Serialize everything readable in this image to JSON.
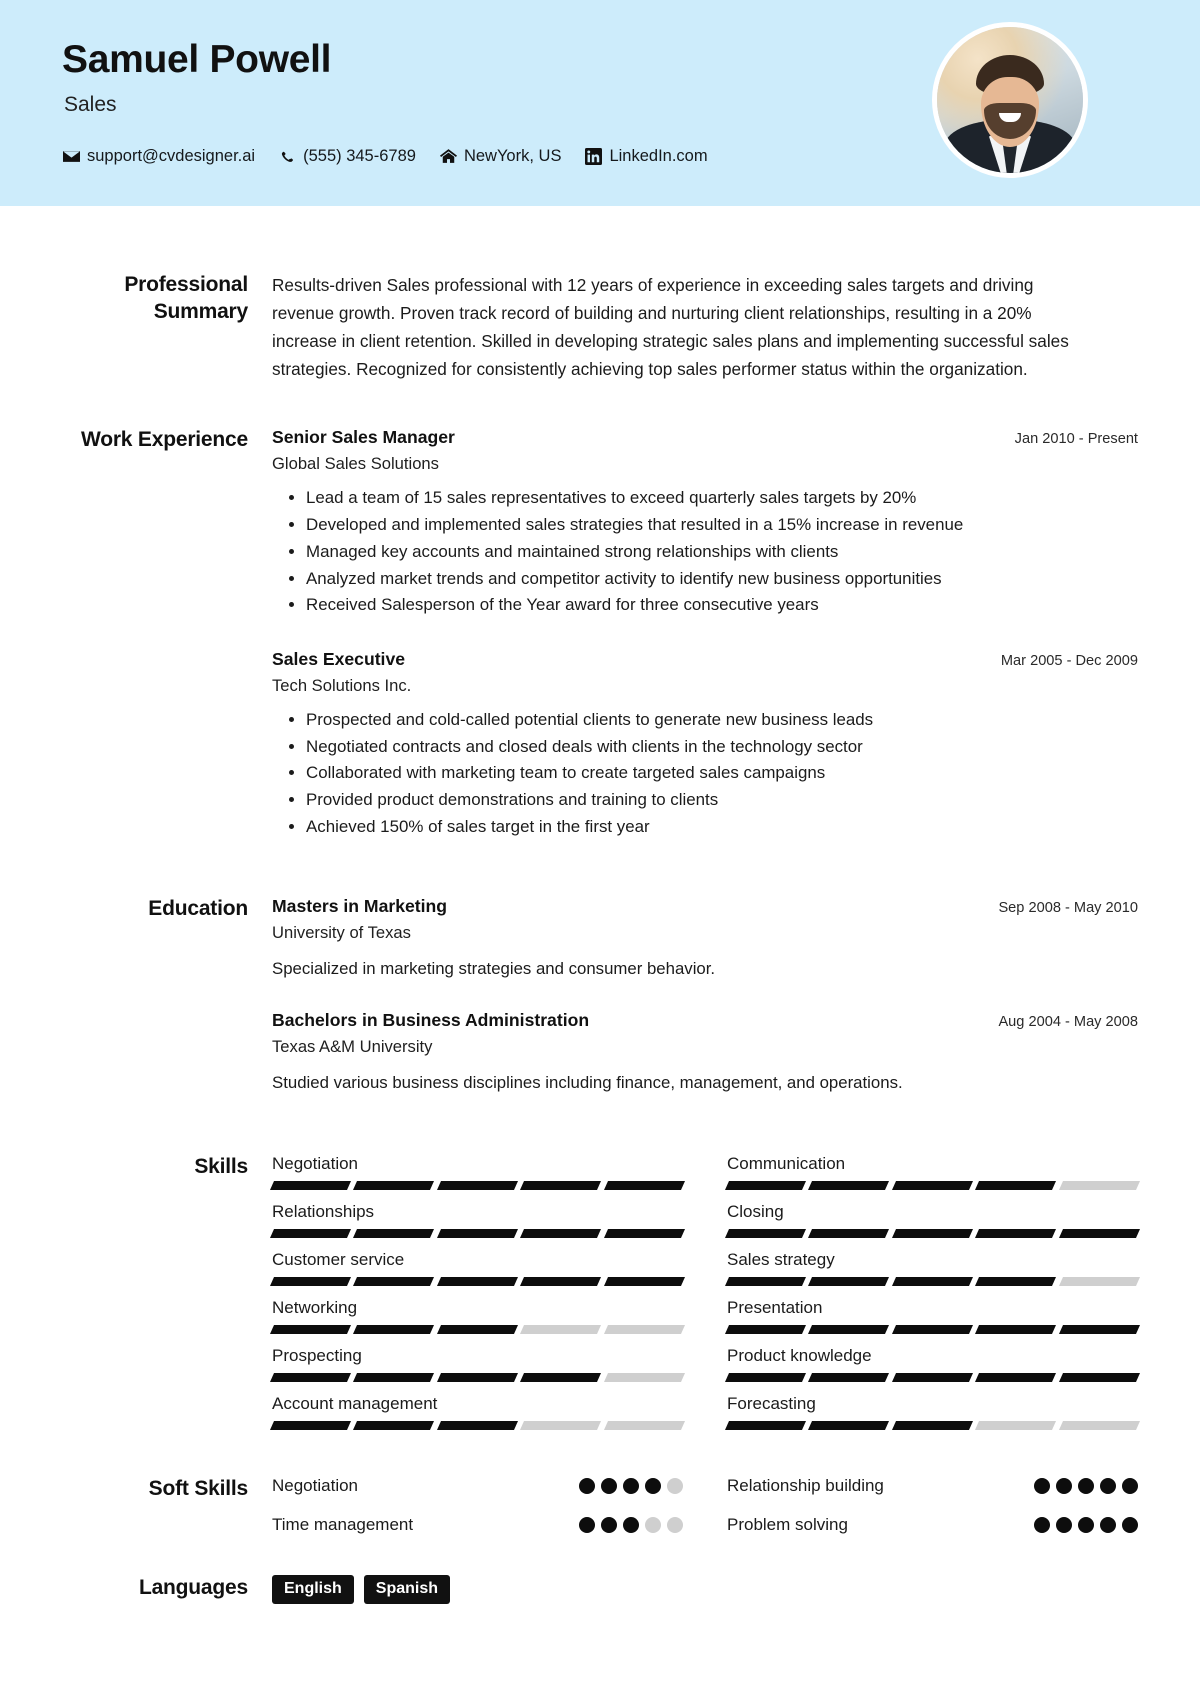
{
  "header": {
    "name": "Samuel Powell",
    "role": "Sales",
    "background_color": "#cdecfb",
    "contacts": [
      {
        "icon": "email-icon",
        "text": "support@cvdesigner.ai"
      },
      {
        "icon": "phone-icon",
        "text": "(555) 345-6789"
      },
      {
        "icon": "home-icon",
        "text": "NewYork, US"
      },
      {
        "icon": "linkedin-icon",
        "text": "LinkedIn.com"
      }
    ]
  },
  "summary": {
    "label": "Professional Summary",
    "text": "Results-driven Sales professional with 12 years of experience in exceeding sales targets and driving revenue growth. Proven track record of building and nurturing client relationships, resulting in a 20% increase in client retention. Skilled in developing strategic sales plans and implementing successful sales strategies. Recognized for consistently achieving top sales performer status within the organization."
  },
  "work": {
    "label": "Work Experience",
    "entries": [
      {
        "title": "Senior Sales Manager",
        "org": "Global Sales Solutions",
        "date": "Jan 2010 - Present",
        "bullets": [
          "Lead a team of 15 sales representatives to exceed quarterly sales targets by 20%",
          "Developed and implemented sales strategies that resulted in a 15% increase in revenue",
          "Managed key accounts and maintained strong relationships with clients",
          "Analyzed market trends and competitor activity to identify new business opportunities",
          "Received Salesperson of the Year award for three consecutive years"
        ]
      },
      {
        "title": "Sales Executive",
        "org": "Tech Solutions Inc.",
        "date": "Mar 2005 - Dec 2009",
        "bullets": [
          "Prospected and cold-called potential clients to generate new business leads",
          "Negotiated contracts and closed deals with clients in the technology sector",
          "Collaborated with marketing team to create targeted sales campaigns",
          "Provided product demonstrations and training to clients",
          "Achieved 150% of sales target in the first year"
        ]
      }
    ]
  },
  "education": {
    "label": "Education",
    "entries": [
      {
        "title": "Masters in Marketing",
        "org": "University of Texas",
        "date": "Sep 2008 - May 2010",
        "desc": "Specialized in marketing strategies and consumer behavior."
      },
      {
        "title": "Bachelors in Business Administration",
        "org": "Texas A&M University",
        "date": "Aug 2004 - May 2008",
        "desc": "Studied various business disciplines including finance, management, and operations."
      }
    ]
  },
  "skills": {
    "label": "Skills",
    "max": 5,
    "items": [
      {
        "name": "Negotiation",
        "level": 5
      },
      {
        "name": "Communication",
        "level": 4
      },
      {
        "name": "Relationships",
        "level": 5
      },
      {
        "name": "Closing",
        "level": 5
      },
      {
        "name": "Customer service",
        "level": 5
      },
      {
        "name": "Sales strategy",
        "level": 4
      },
      {
        "name": "Networking",
        "level": 3
      },
      {
        "name": "Presentation",
        "level": 5
      },
      {
        "name": "Prospecting",
        "level": 4
      },
      {
        "name": "Product knowledge",
        "level": 5
      },
      {
        "name": "Account management",
        "level": 3
      },
      {
        "name": "Forecasting",
        "level": 3
      }
    ]
  },
  "soft_skills": {
    "label": "Soft Skills",
    "max": 5,
    "items": [
      {
        "name": "Negotiation",
        "level": 4
      },
      {
        "name": "Relationship building",
        "level": 5
      },
      {
        "name": "Time management",
        "level": 3
      },
      {
        "name": "Problem solving",
        "level": 5
      }
    ]
  },
  "languages": {
    "label": "Languages",
    "items": [
      "English",
      "Spanish"
    ]
  }
}
